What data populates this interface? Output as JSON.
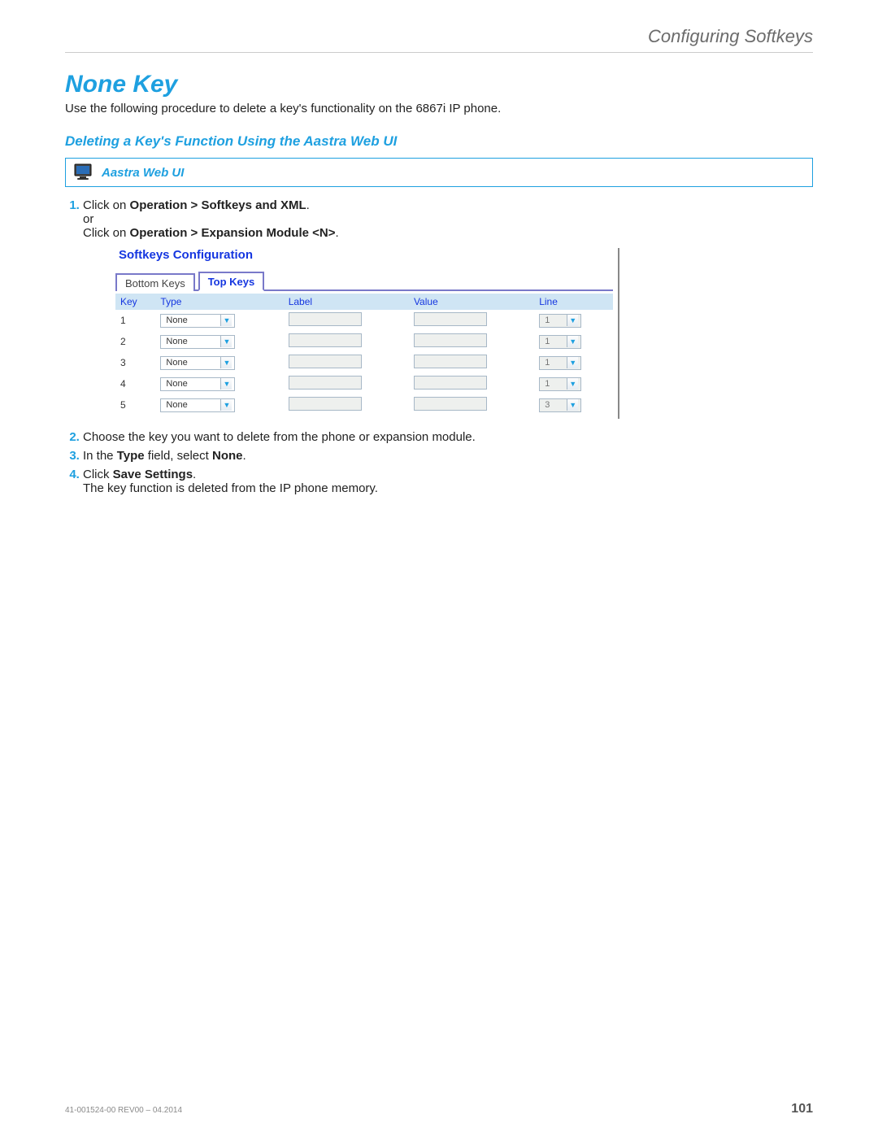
{
  "header": {
    "chapter": "Configuring Softkeys"
  },
  "section": {
    "title": "None Key",
    "intro": "Use the following procedure to delete a key's functionality on the 6867i IP phone.",
    "subsection": "Deleting a Key's Function Using the Aastra Web UI"
  },
  "uibox": {
    "label": "Aastra Web UI"
  },
  "steps": {
    "s1a": "Click on ",
    "s1a_bold": "Operation > Softkeys and XML",
    "s1a_end": ".",
    "s1or": "or",
    "s1b": "Click on ",
    "s1b_bold": "Operation > Expansion Module <N>",
    "s1b_end": ".",
    "s2": "Choose the key you want to delete from the phone or expansion module.",
    "s3a": "In the ",
    "s3b": "Type",
    "s3c": " field, select ",
    "s3d": "None",
    "s3e": ".",
    "s4a": "Click ",
    "s4b": "Save Settings",
    "s4c": ".",
    "s4sub": "The key function is deleted from the IP phone memory."
  },
  "screenshot": {
    "title": "Softkeys Configuration",
    "tabs": {
      "bottom": "Bottom Keys",
      "top": "Top Keys"
    },
    "columns": {
      "key": "Key",
      "type": "Type",
      "label": "Label",
      "value": "Value",
      "line": "Line"
    },
    "rows": [
      {
        "key": "1",
        "type": "None",
        "line": "1"
      },
      {
        "key": "2",
        "type": "None",
        "line": "1"
      },
      {
        "key": "3",
        "type": "None",
        "line": "1"
      },
      {
        "key": "4",
        "type": "None",
        "line": "1"
      },
      {
        "key": "5",
        "type": "None",
        "line": "3"
      }
    ]
  },
  "footer": {
    "doc": "41-001524-00 REV00 – 04.2014",
    "page": "101"
  }
}
